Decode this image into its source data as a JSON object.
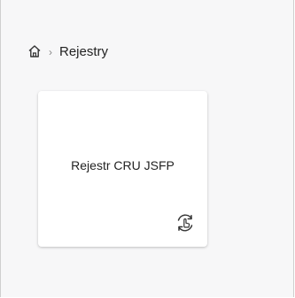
{
  "breadcrumb": {
    "home_icon": "home-icon",
    "separator": "›",
    "current": "Rejestry"
  },
  "cards": [
    {
      "title": "Rejestr CRU JSFP",
      "icon": "refresh-hand-icon"
    }
  ]
}
